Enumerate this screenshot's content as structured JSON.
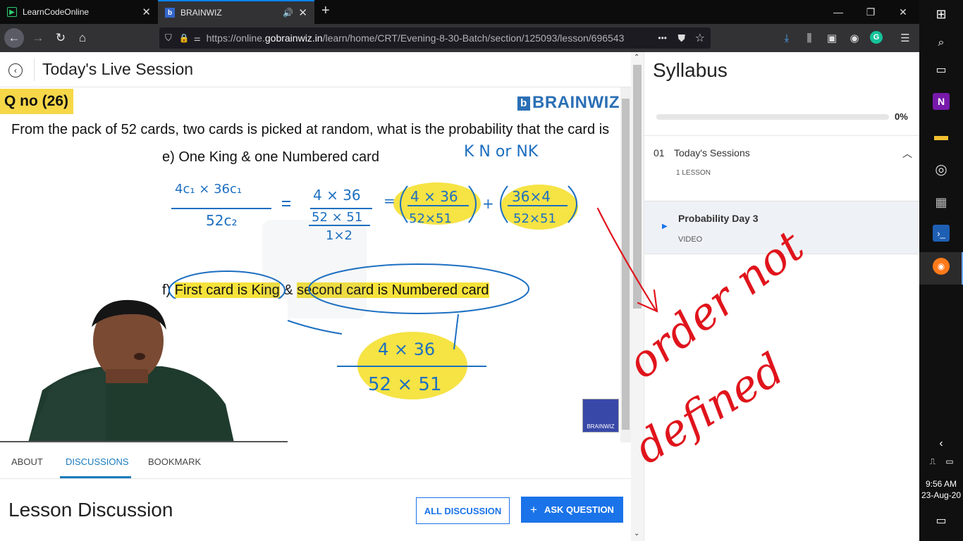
{
  "browser": {
    "tabs": [
      {
        "title": "LearnCodeOnline",
        "active": false
      },
      {
        "title": "BRAINWIZ",
        "active": true
      }
    ],
    "url_prefix": "https://online.",
    "url_host": "gobrainwiz.in",
    "url_path": "/learn/home/CRT/Evening-8-30-Batch/section/125093/lesson/696543",
    "url_more": "•••"
  },
  "header": {
    "title": "Today's Live Session"
  },
  "video": {
    "qno": "Q no (26)",
    "brand": "BRAINWIZ",
    "question": "From the pack of 52 cards, two cards is picked at random, what is the probability that the card is",
    "part_e": "e) One King & one Numbered card",
    "part_f_prefix": "f) ",
    "part_f_a": "First card is King",
    "part_f_mid": " & ",
    "part_f_b": "second card is Numbered card",
    "ink_kn": "K N or NK",
    "ink_e_lhs_num": "4c₁ × 36c₁",
    "ink_e_lhs_den": "52c₂",
    "ink_e_mid_num": "4 × 36",
    "ink_e_mid_den": "52 × 51",
    "ink_e_mid_den2": "1×2",
    "ink_e_t1_num": "4 × 36",
    "ink_e_t1_den": "52×51",
    "ink_e_t2_num": "36×4",
    "ink_e_t2_den": "52×51",
    "ink_f_num": "4 × 36",
    "ink_f_den": "52 × 51",
    "badge_text": "BRAINWIZ"
  },
  "tabs": {
    "about": "ABOUT",
    "discussions": "DISCUSSIONS",
    "bookmark": "BOOKMARK"
  },
  "discussion": {
    "title": "Lesson Discussion",
    "all_button": "ALL DISCUSSION",
    "ask_button": "ASK QUESTION"
  },
  "syllabus": {
    "title": "Syllabus",
    "progress_label": "0%",
    "progress_fraction": 0,
    "section": {
      "number": "01",
      "name": "Today's Sessions",
      "count": "1 LESSON"
    },
    "lesson": {
      "name": "Probability Day 3",
      "type": "VIDEO"
    }
  },
  "annotation": {
    "line1": "order not",
    "line2": "defined"
  },
  "taskbar": {
    "time": "9:56 AM",
    "date": "23-Aug-20"
  }
}
